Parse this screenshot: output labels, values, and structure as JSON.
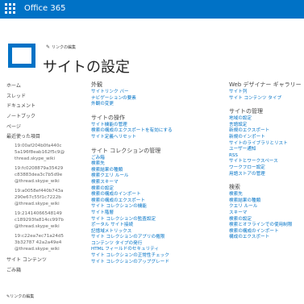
{
  "topbar": {
    "brand": "Office 365"
  },
  "edit_links_label": "リンクの編集",
  "page_title": "サイトの設定",
  "leftnav": {
    "items": [
      "ホーム",
      "スレッド",
      "ドキュメント",
      "ノートブック",
      "ページ"
    ],
    "recent_label": "最近使った項目",
    "recent": [
      [
        "19:00af204b0fa440c",
        "5a196f8eab162f5c9@",
        "thread.skype_wiki"
      ],
      [
        "19:fc0208879a35429",
        "c83883dea3c7b5d9e",
        "@thread.skype_wiki"
      ],
      [
        "19:a0058ef440b743a",
        "290e67c55f1c7222b",
        "@thread.skype_wiki"
      ],
      [
        "19:21414066548149",
        "c189293fa814cc997b",
        "@thread.skype_wiki"
      ],
      [
        "19:c22ea7ec71a24d5",
        "3b32787 42a2a49e4",
        "@thread.skype_wiki"
      ]
    ],
    "site_contents": "サイト コンテンツ",
    "recycle": "ごみ箱"
  },
  "columns": [
    {
      "sections": [
        {
          "header": "外観",
          "links": [
            "サイトリンク バー",
            "ナビゲーションの要素",
            "外観の変更"
          ]
        },
        {
          "header": "サイトの操作",
          "links": [
            "サイト機能の管理",
            "検索の構成のエクスポートを有効にする",
            "サイト定義へリセット"
          ]
        },
        {
          "header": "サイト コレクションの管理",
          "links": [
            "ごみ箱",
            "検索先",
            "検索結果の種類",
            "検索クエリ ルール",
            "検索スキーマ",
            "検索の設定",
            "検索の構成のインポート",
            "検索の構成のエクスポート",
            "サイト コレクションの機能",
            "サイト階層",
            "サイト コレクションの監査設定",
            "ポータル サイト接続",
            "記憶域メトリックス",
            "サイト コレクションのアプリの権限",
            "コンテンツ タイプの発行",
            "HTML フィールドのセキュリティ",
            "サイト コレクションの正常性チェック",
            "サイト コレクションのアップグレード"
          ]
        }
      ]
    },
    {
      "sections": [
        {
          "header": "Web デザイナー ギャラリー",
          "links": [
            "サイト列",
            "サイト コンテンツ タイプ"
          ]
        },
        {
          "header": "サイトの管理",
          "links": [
            "地域の設定",
            "言語設定",
            "新規のエクスポート",
            "新規のインポート",
            "サイトのライブラリとリスト",
            "ユーザー通知",
            "RSS",
            "サイトとワークスペース",
            "ワークフロー設定",
            "用語ストアの管理"
          ]
        },
        {
          "header": "検索",
          "links": [
            "検索先",
            "検索結果の種類",
            "クエリ ルール",
            "スキーマ",
            "検索の設定",
            "検索とオフラインでの使用制限",
            "検索の構成のインポート",
            "構成のエクスポート"
          ]
        }
      ]
    }
  ]
}
